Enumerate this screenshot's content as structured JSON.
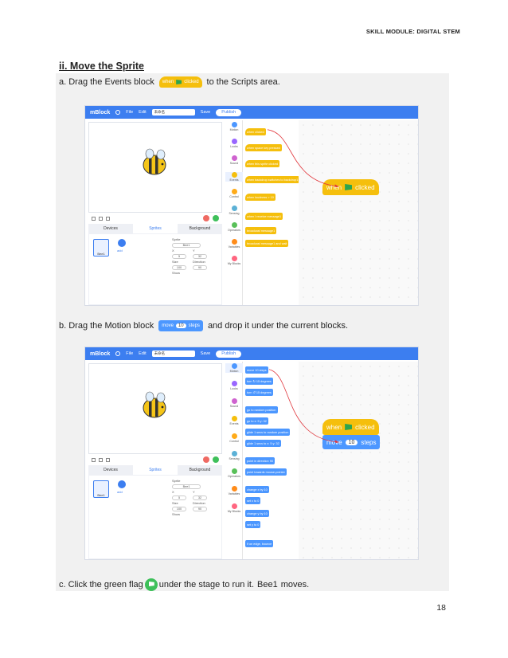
{
  "header": {
    "module_title": "SKILL MODULE: DIGITAL STEM"
  },
  "section": {
    "heading": "ii. Move the Sprite"
  },
  "steps": {
    "a": {
      "prefix": "a.  Drag the Events block",
      "suffix": "to the Scripts area."
    },
    "b": {
      "prefix": "b. Drag the Motion block",
      "suffix": "and drop it under the current blocks."
    },
    "c": {
      "prefix": "c. Click the green flag",
      "middle": "under the stage to run it.",
      "sprite_name": "Bee1",
      "suffix": "moves."
    }
  },
  "inline_blocks": {
    "when_label": "when",
    "clicked_label": "clicked",
    "move_label": "move",
    "move_value": "10",
    "steps_label": "steps"
  },
  "app": {
    "logo": "mBlock",
    "menu_file": "File",
    "menu_edit": "Edit",
    "project_title": "未命名",
    "save": "Save",
    "publish": "Publish",
    "tabs": [
      "Devices",
      "Sprites",
      "Background"
    ],
    "sprite_thumb_label": "Bee1",
    "add_label": "add",
    "props": {
      "sprite": "Sprite",
      "name": "Bee1",
      "x_label": "X",
      "x": "5",
      "y_label": "Y",
      "y": "32",
      "size_label": "Size",
      "size": "100",
      "dir_label": "Direction",
      "dir": "90",
      "show_label": "Show"
    },
    "categories": [
      "Motion",
      "Looks",
      "Sound",
      "Events",
      "Control",
      "Sensing",
      "Operators",
      "Variables",
      "My Blocks"
    ],
    "category_colors": [
      "#4c97ff",
      "#9966ff",
      "#cf63cf",
      "#f5bf0d",
      "#ffab19",
      "#5cb1d6",
      "#59c059",
      "#ff8c1a",
      "#ff6680"
    ],
    "events_palette": [
      "when clicked",
      "when space key pressed",
      "when this sprite clicked",
      "when backdrop switches to backdrop1",
      "when loudness > 10",
      "when I receive message1",
      "broadcast message1",
      "broadcast message1 and wait"
    ],
    "motion_palette": [
      "move 10 steps",
      "turn ↻ 15 degrees",
      "turn ↺ 15 degrees",
      "go to random position",
      "go to x: 5 y: 32",
      "glide 1 secs to random position",
      "glide 1 secs to x: 5 y: 32",
      "point in direction 90",
      "point towards mouse-pointer",
      "change x by 10",
      "set x to 0",
      "change y by 10",
      "set y to 0",
      "if on edge, bounce"
    ],
    "script_when": "when",
    "script_clicked": "clicked",
    "script_move": "move",
    "script_move_value": "10",
    "script_steps": "steps"
  },
  "page_number": "18"
}
